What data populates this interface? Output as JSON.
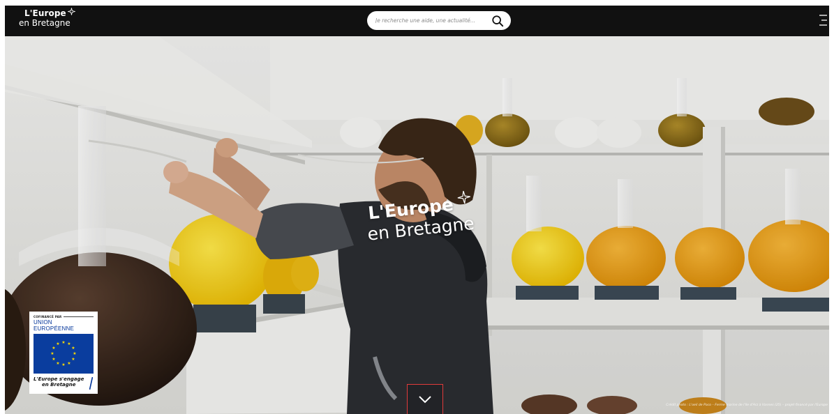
{
  "header": {
    "logo_line1": "L'Europe",
    "logo_line2": "en Bretagne",
    "search_placeholder": "Je recherche une aide, une actualité...",
    "search_icon": "search-icon",
    "menu_icon": "hamburger-menu-icon"
  },
  "hero": {
    "title_line1": "L'Europe",
    "title_line2": "en Bretagne",
    "star_icon": "sparkle-star-icon",
    "scroll_icon": "chevron-down-icon",
    "credit": "Crédit photo : L'oeil de Paco – Ferme marine de l'île d'Arz à Vannes (25) – projet financé par l'Europe"
  },
  "eu_badge": {
    "cofinance": "COFINANCÉ PAR",
    "union": "UNION EUROPÉENNE",
    "engage_line1": "L'Europe s'engage",
    "engage_line2": "en Bretagne",
    "flag_icon": "eu-flag-icon"
  },
  "colors": {
    "topbar": "#111111",
    "eu_blue": "#0a3d9e",
    "eu_star": "#ffdd00",
    "highlight_border": "#e13b3b"
  }
}
